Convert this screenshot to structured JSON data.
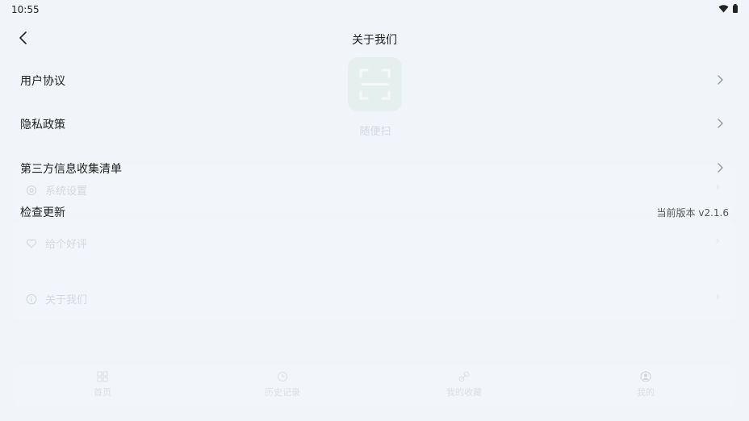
{
  "status_bar": {
    "time": "10:55",
    "wifi_icon": "wifi-icon",
    "battery_icon": "battery-icon"
  },
  "header": {
    "title": "关于我们",
    "back_icon": "chevron-left-icon"
  },
  "menu": [
    {
      "label": "用户协议",
      "icon": "chevron-right-icon"
    },
    {
      "label": "隐私政策",
      "icon": "chevron-right-icon"
    },
    {
      "label": "第三方信息收集清单",
      "icon": "chevron-right-icon"
    },
    {
      "label": "检查更新",
      "value": "当前版本 v2.1.6"
    }
  ],
  "background": {
    "scan_label": "随便扫",
    "rows": [
      {
        "label": "系统设置",
        "icon": "gear-icon"
      },
      {
        "label": "给个好评",
        "icon": "heart-icon"
      },
      {
        "label": "关于我们",
        "icon": "info-icon"
      }
    ],
    "tabs": [
      {
        "label": "首页",
        "icon": "grid-icon"
      },
      {
        "label": "历史记录",
        "icon": "clock-icon"
      },
      {
        "label": "我的收藏",
        "icon": "link-icon"
      },
      {
        "label": "我的",
        "icon": "user-icon"
      }
    ]
  },
  "colors": {
    "background": "#f1f4f8",
    "accent": "#cfe9da",
    "text": "#222222"
  }
}
